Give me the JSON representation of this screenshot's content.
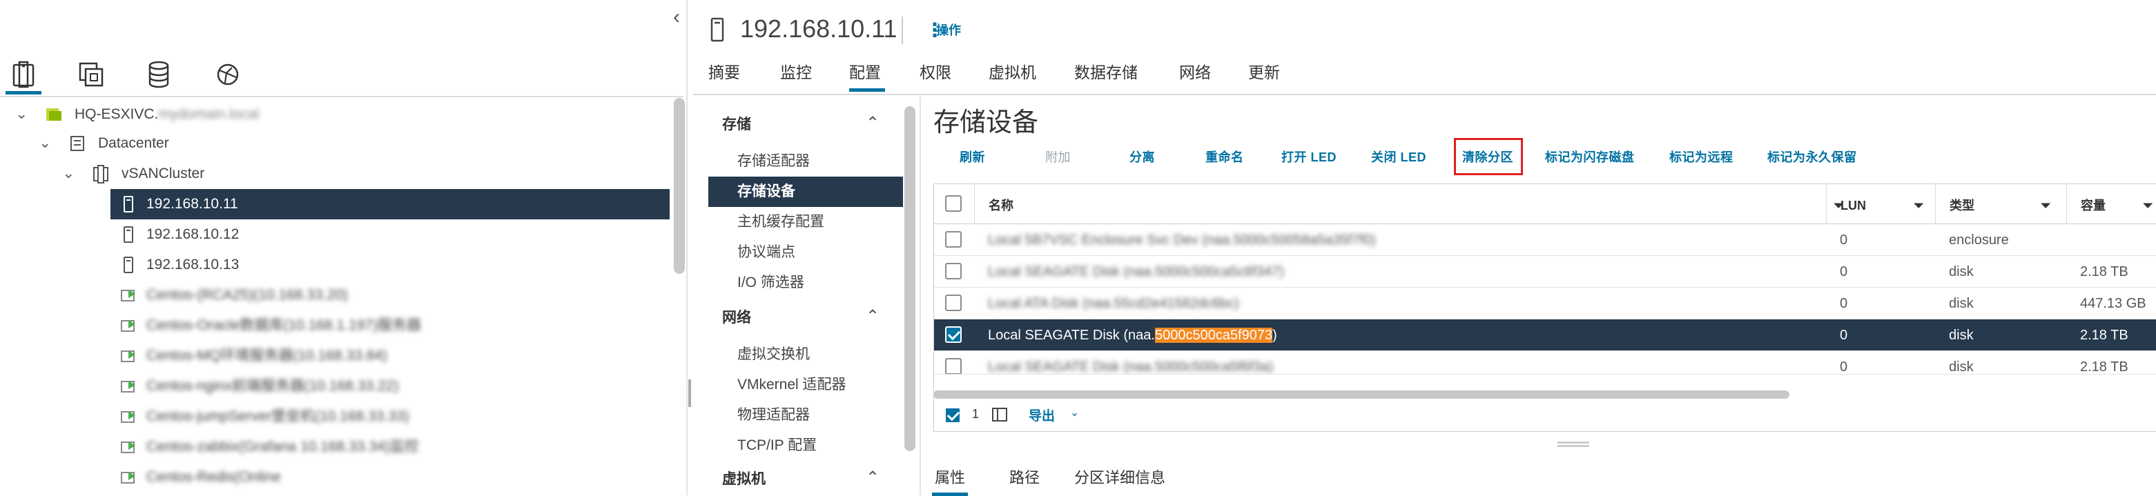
{
  "left": {
    "nav_icons": [
      "hosts-clusters-icon",
      "vms-templates-icon",
      "storage-icon",
      "networking-icon"
    ],
    "tree": [
      {
        "label": "HQ-ESXIVC.",
        "suffix": "mydomain.local",
        "icon": "vcenter-icon"
      },
      {
        "label": "Datacenter",
        "icon": "datacenter-icon"
      },
      {
        "label": "vSANCluster",
        "icon": "cluster-icon"
      },
      {
        "label": "192.168.10.11",
        "icon": "host-icon",
        "selected": true
      },
      {
        "label": "192.168.10.12",
        "icon": "host-icon"
      },
      {
        "label": "192.168.10.13",
        "icon": "host-icon"
      },
      {
        "label": "Centos-(RCA25)(10.168.33.20)",
        "icon": "vm-icon",
        "blurred": true
      },
      {
        "label": "Centos-Oracle数据库(10.168.1.197)服务器",
        "icon": "vm-icon",
        "blurred": true
      },
      {
        "label": "Centos-MQ环境服务器(10.168.33.84)",
        "icon": "vm-icon",
        "blurred": true
      },
      {
        "label": "Centos-nginx前端服务器(10.168.33.22)",
        "icon": "vm-icon",
        "blurred": true
      },
      {
        "label": "Centos-jumpServer堡垒机(10.168.33.33)",
        "icon": "vm-icon",
        "blurred": true
      },
      {
        "label": "Centos-zabbix(Grafana 10.168.33.34)监控",
        "icon": "vm-icon",
        "blurred": true
      },
      {
        "label": "Centos-Redis(Online",
        "icon": "vm-icon",
        "blurred": true
      }
    ]
  },
  "header": {
    "title": "192.168.10.11",
    "actions_label": "操作"
  },
  "tabs": [
    "摘要",
    "监控",
    "配置",
    "权限",
    "虚拟机",
    "数据存储",
    "网络",
    "更新"
  ],
  "subnav": {
    "sections": [
      {
        "title": "存储",
        "items": [
          "存储适配器",
          "存储设备",
          "主机缓存配置",
          "协议端点",
          "I/O 筛选器"
        ]
      },
      {
        "title": "网络",
        "items": [
          "虚拟交换机",
          "VMkernel 适配器",
          "物理适配器",
          "TCP/IP 配置"
        ]
      },
      {
        "title": "虚拟机",
        "items": []
      }
    ]
  },
  "panel": {
    "title": "存储设备",
    "toolbar": [
      "刷新",
      "附加",
      "分离",
      "重命名",
      "打开 LED",
      "关闭 LED",
      "清除分区",
      "标记为闪存磁盘",
      "标记为远程",
      "标记为永久保留"
    ],
    "columns": [
      "名称",
      "LUN",
      "类型",
      "容量"
    ],
    "rows": [
      {
        "name": "Local 5B7VSC Enclosure Svc Dev (naa.5000c50058a5a35f7f0)",
        "lun": "0",
        "type": "enclosure",
        "capacity": "",
        "blurred": true
      },
      {
        "name": "Local SEAGATE Disk (naa.5000c500ca5c6f347)",
        "lun": "0",
        "type": "disk",
        "capacity": "2.18 TB",
        "blurred": true
      },
      {
        "name": "Local ATA Disk (naa.55cd2e41582dc6bc)",
        "lun": "0",
        "type": "disk",
        "capacity": "447.13 GB",
        "blurred": true
      },
      {
        "name_prefix": "Local SEAGATE Disk (naa.",
        "name_highlight": "5000c500ca5f9073",
        "name_suffix": ")",
        "lun": "0",
        "type": "disk",
        "capacity": "2.18 TB",
        "selected": true
      },
      {
        "name": "Local SEAGATE Disk (naa.5000c500ca5f6f3a)",
        "lun": "0",
        "type": "disk",
        "capacity": "2.18 TB",
        "blurred": true
      }
    ],
    "footer": {
      "selected_count": "1",
      "export_label": "导出"
    },
    "sub_tabs": [
      "属性",
      "路径",
      "分区详细信息"
    ]
  }
}
